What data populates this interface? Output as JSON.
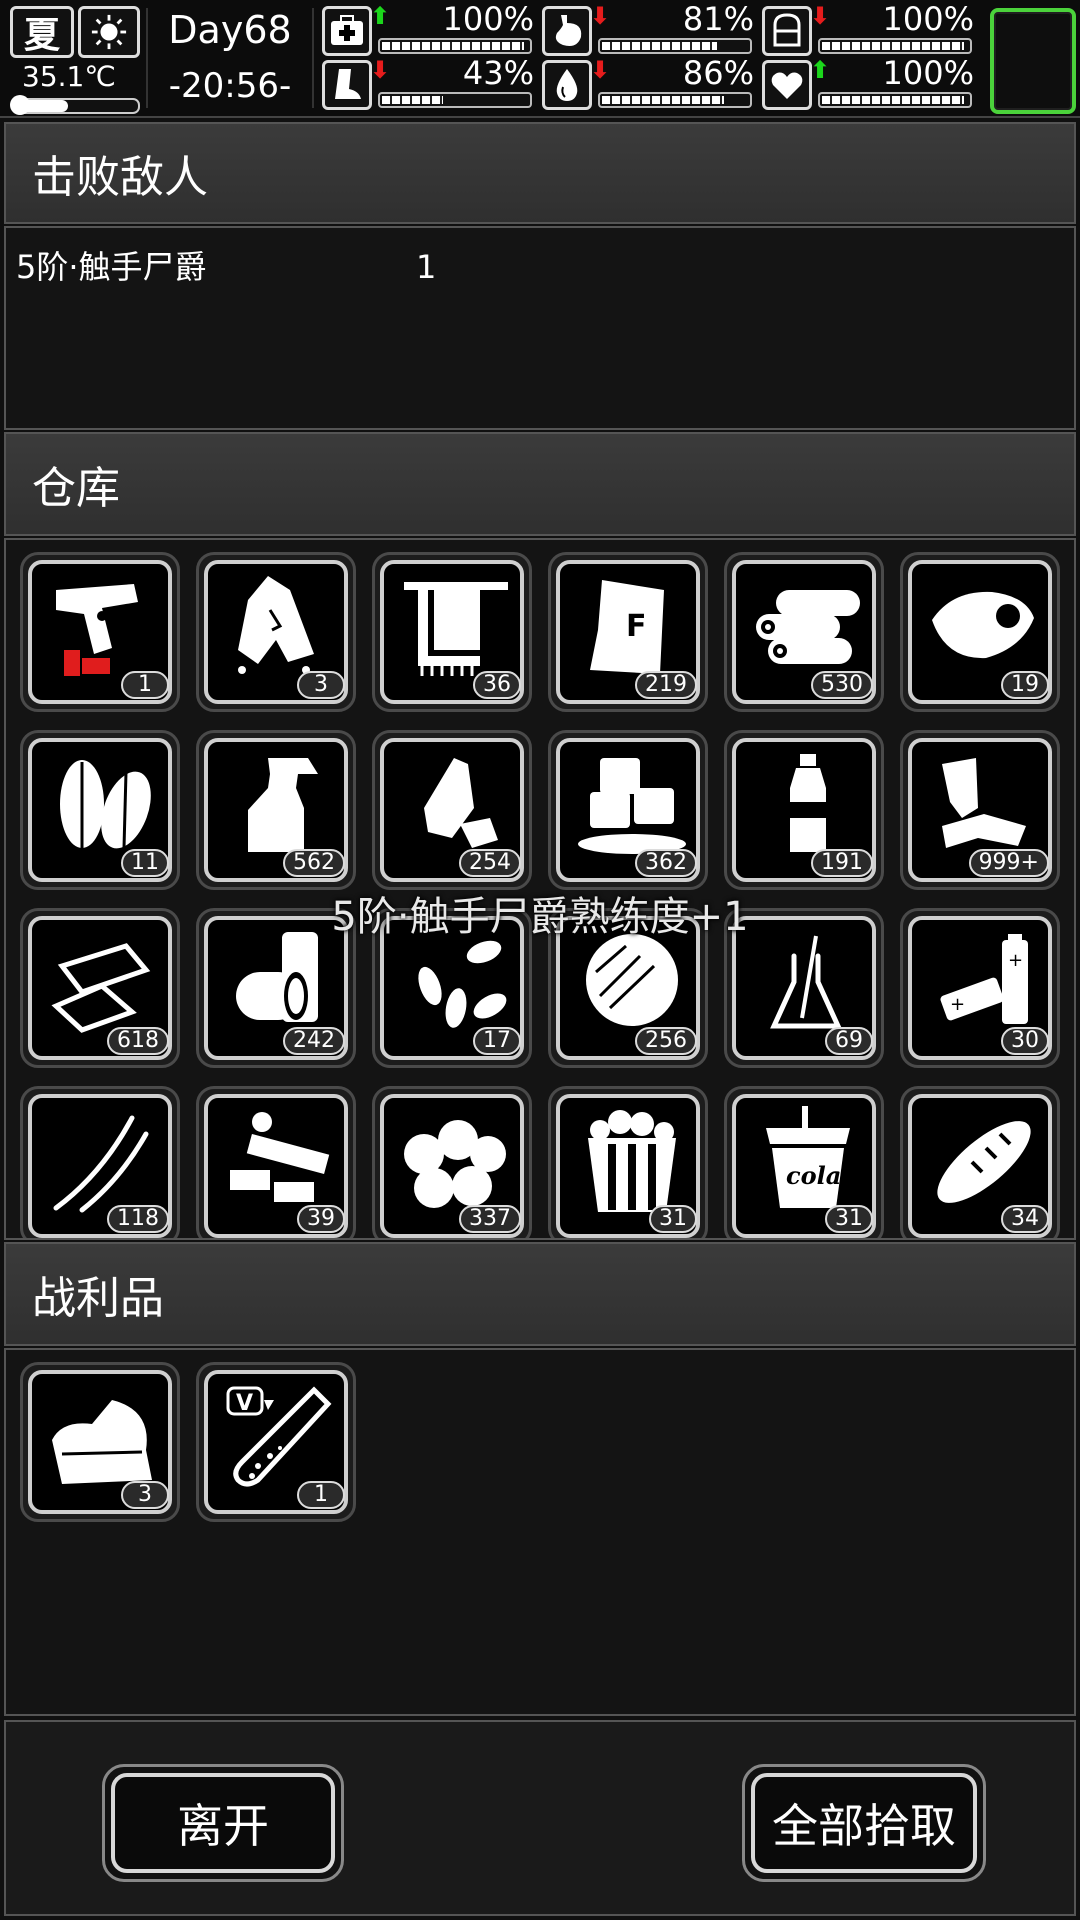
{
  "status": {
    "season": "夏",
    "weather_icon": "sun-icon",
    "temperature": "35.1℃",
    "temperature_level": 0.45,
    "day": "Day68",
    "time": "-20:56-",
    "stats": [
      {
        "name": "health",
        "icon": "medkit-icon",
        "arrow": "up",
        "value": "100%",
        "level": 1.0
      },
      {
        "name": "hunger",
        "icon": "stomach-icon",
        "arrow": "down",
        "value": "81%",
        "level": 0.81
      },
      {
        "name": "mental",
        "icon": "brain-icon",
        "arrow": "down",
        "value": "100%",
        "level": 1.0
      },
      {
        "name": "stamina",
        "icon": "foot-icon",
        "arrow": "down",
        "value": "43%",
        "level": 0.43
      },
      {
        "name": "thirst",
        "icon": "water-drop-icon",
        "arrow": "down",
        "value": "86%",
        "level": 0.86
      },
      {
        "name": "mood",
        "icon": "heart-icon",
        "arrow": "up",
        "value": "100%",
        "level": 1.0
      }
    ],
    "accent_color": "#4bd23b"
  },
  "enemies": {
    "title": "击败敌人",
    "rows": [
      {
        "name": "5阶·触手尸爵",
        "count": "1"
      }
    ]
  },
  "warehouse": {
    "title": "仓库",
    "items": [
      {
        "icon": "flare-gun-icon",
        "count": "1"
      },
      {
        "icon": "torn-cloth-icon",
        "count": "3"
      },
      {
        "icon": "towel-icon",
        "count": "36"
      },
      {
        "icon": "flour-bag-icon",
        "count": "219"
      },
      {
        "icon": "logs-icon",
        "count": "530"
      },
      {
        "icon": "raw-meat-icon",
        "count": "19"
      },
      {
        "icon": "leaves-icon",
        "count": "11"
      },
      {
        "icon": "spray-bottle-icon",
        "count": "562"
      },
      {
        "icon": "crushed-bottle-icon",
        "count": "254"
      },
      {
        "icon": "ice-cubes-icon",
        "count": "362"
      },
      {
        "icon": "water-bottle-icon",
        "count": "191"
      },
      {
        "icon": "scrap-cloth-icon",
        "count": "999+"
      },
      {
        "icon": "paper-scraps-icon",
        "count": "618"
      },
      {
        "icon": "cans-icon",
        "count": "242"
      },
      {
        "icon": "seeds-icon",
        "count": "17"
      },
      {
        "icon": "fiber-ball-icon",
        "count": "256"
      },
      {
        "icon": "flask-icon",
        "count": "69"
      },
      {
        "icon": "batteries-icon",
        "count": "30"
      },
      {
        "icon": "wires-icon",
        "count": "118"
      },
      {
        "icon": "electronic-parts-icon",
        "count": "39"
      },
      {
        "icon": "cotton-icon",
        "count": "337"
      },
      {
        "icon": "popcorn-icon",
        "count": "31"
      },
      {
        "icon": "cola-cup-icon",
        "count": "31"
      },
      {
        "icon": "bread-icon",
        "count": "34"
      }
    ],
    "cola_label": "cola"
  },
  "overlay_message": "5阶·触手尸爵熟练度+1",
  "loot": {
    "title": "战利品",
    "items": [
      {
        "icon": "cloth-pile-icon",
        "count": "3"
      },
      {
        "icon": "vaccine-tube-icon",
        "count": "1",
        "tag": "V"
      }
    ]
  },
  "buttons": {
    "leave": "离开",
    "pick_all": "全部拾取"
  }
}
